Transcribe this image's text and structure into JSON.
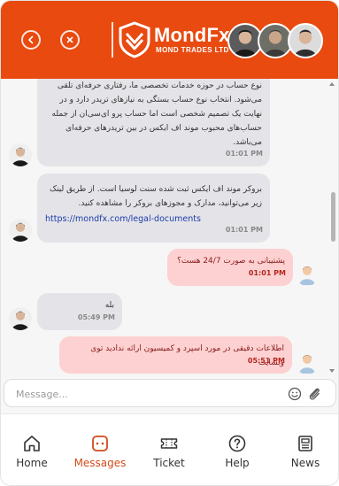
{
  "header": {
    "brand_name": "MondFx",
    "brand_tagline": "MOND TRADES LTD",
    "accent": "#e84a10"
  },
  "messages": [
    {
      "role": "agent",
      "lines": [
        "نوع حساب در حوزه خدمات تخصصی ما، رفتاری حرفه‌ای تلقی",
        "می‌شود. انتخاب نوع حساب بستگی به نیازهای تریدر دارد و در",
        "نهایت یک تصمیم شخصی است اما حساب پرو ای‌سی‌ان از جمله",
        "حساب‌های محبوب موند اف ایکس در بین تریدرهای حرفه‌ای",
        "می‌باشد."
      ],
      "time": "01:01 PM"
    },
    {
      "role": "agent",
      "lines": [
        "بروکر موند اف ایکس ثبت شده سنت لوسیا است. از طریق لینک",
        "زیر می‌توانید، مدارک و مجوزهای بروکر را مشاهده کنید."
      ],
      "link": "https://mondfx.com/legal-documents",
      "time": "01:01 PM"
    },
    {
      "role": "user",
      "lines": [
        "پشتیبانی به صورت 24/7 هست؟"
      ],
      "time": "01:01 PM"
    },
    {
      "role": "agent",
      "lines": [
        "بله"
      ],
      "time": "05:49 PM"
    },
    {
      "role": "user",
      "lines": [
        "اطلاعات دقیقی در مورد اسپرد و کمیسیون ارائه ندادید توی وبسایت"
      ],
      "time": "05:51 PM"
    }
  ],
  "composer": {
    "placeholder": "Message..."
  },
  "nav": [
    {
      "label": "Home",
      "icon": "home-icon",
      "active": false
    },
    {
      "label": "Messages",
      "icon": "messages-icon",
      "active": true
    },
    {
      "label": "Ticket",
      "icon": "ticket-icon",
      "active": false
    },
    {
      "label": "Help",
      "icon": "help-icon",
      "active": false
    },
    {
      "label": "News",
      "icon": "news-icon",
      "active": false
    }
  ]
}
